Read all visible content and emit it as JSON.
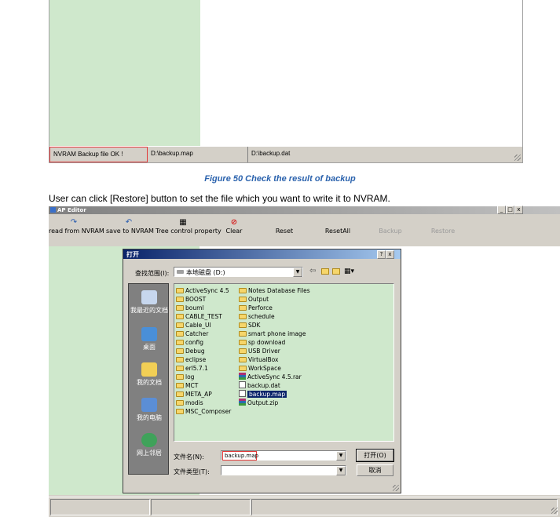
{
  "top_screenshot": {
    "status": [
      "NVRAM Backup file OK !",
      "D:\\backup.map",
      "D:\\backup.dat"
    ]
  },
  "caption": "Figure 50 Check the result of backup",
  "body_text": "User can click [Restore] button to set the file which you want to write it to NVRAM.",
  "app": {
    "title": "AP Editor",
    "window_controls": [
      "_",
      "□",
      "x"
    ],
    "toolbar": [
      {
        "label": "read from NVRAM",
        "icon": "redo-arrow-icon"
      },
      {
        "label": "save to NVRAM",
        "icon": "undo-arrow-icon"
      },
      {
        "label": "Tree control property",
        "icon": "property-icon"
      },
      {
        "label": "Clear",
        "icon": "clear-icon"
      },
      {
        "label": "Reset"
      },
      {
        "label": "ResetAll"
      },
      {
        "label": "Backup"
      },
      {
        "label": "Restore"
      }
    ]
  },
  "dialog": {
    "title": "打开",
    "title_buttons": [
      "?",
      "x"
    ],
    "look_in_label": "查找范围(I):",
    "look_in_value": "本地磁盘 (D:)",
    "places": [
      "我最近的文档",
      "桌面",
      "我的文档",
      "我的电脑",
      "网上邻居"
    ],
    "files_col1": [
      "ActiveSync 4.5",
      "BOOST",
      "bouml",
      "CABLE_TEST",
      "Cable_UI",
      "Catcher",
      "config",
      "Debug",
      "eclipse",
      "erl5.7.1",
      "log",
      "MCT",
      "META_AP",
      "modis",
      "MSC_Composer"
    ],
    "files_col2": [
      "Notes Database Files",
      "Output",
      "Perforce",
      "schedule",
      "SDK",
      "smart phone image",
      "sp download",
      "USB Driver",
      "VirtualBox",
      "WorkSpace",
      "ActiveSync 4.5.rar",
      "backup.dat",
      "backup.map",
      "Output.zip"
    ],
    "selected_file": "backup.map",
    "filename_label": "文件名(N):",
    "filename_value": "backup.map",
    "filetype_label": "文件类型(T):",
    "filetype_value": "",
    "open_button": "打开(O)",
    "cancel_button": "取消"
  },
  "colors": {
    "green_panel": "#cfe8cc",
    "title_bar": "#0a246a",
    "dialog_body": "#d4d0c8",
    "places_bar": "#808080",
    "caption": "#2a62ad",
    "highlight": "#e23a3a"
  }
}
